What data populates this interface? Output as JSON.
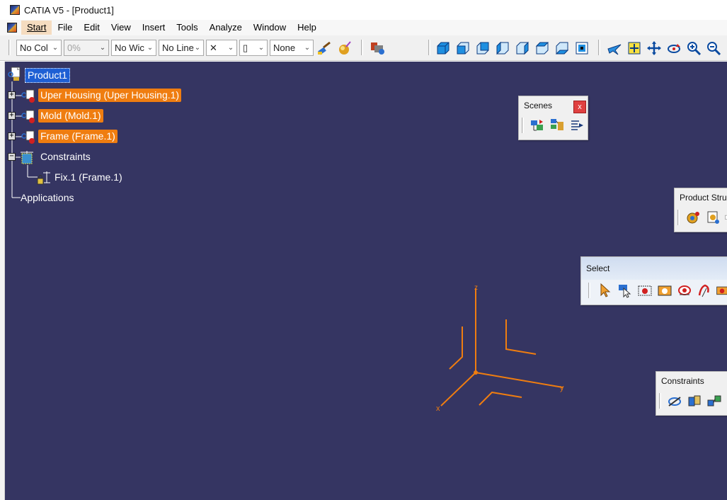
{
  "window": {
    "title": "CATIA V5 - [Product1]"
  },
  "menu": {
    "items": [
      {
        "label": "Start",
        "active": true
      },
      {
        "label": "File"
      },
      {
        "label": "Edit"
      },
      {
        "label": "View"
      },
      {
        "label": "Insert"
      },
      {
        "label": "Tools"
      },
      {
        "label": "Analyze"
      },
      {
        "label": "Window"
      },
      {
        "label": "Help"
      }
    ]
  },
  "toolbar": {
    "color_select": "No Col",
    "transparency_select": "0%",
    "width_select": "No Wic",
    "linetype_select": "No Line",
    "point_select": "✕",
    "layer_select": "▯",
    "render_select": "None",
    "view_icons": [
      "isometric-view-icon",
      "front-view-icon",
      "back-view-icon",
      "left-view-icon",
      "right-view-icon",
      "top-view-icon",
      "bottom-view-icon",
      "named-views-icon"
    ],
    "nav_icons": [
      "fly-mode-icon",
      "fit-all-icon",
      "pan-icon",
      "rotate-icon",
      "zoom-in-icon",
      "zoom-out-icon"
    ]
  },
  "tree": {
    "root": "Product1",
    "parts": [
      {
        "label": "Uper Housing (Uper Housing.1)"
      },
      {
        "label": "Mold (Mold.1)"
      },
      {
        "label": "Frame (Frame.1)"
      }
    ],
    "constraints": "Constraints",
    "fix": "Fix.1 (Frame.1)",
    "applications": "Applications"
  },
  "axis": {
    "x": "x",
    "y": "y",
    "z": "z",
    "color": "#ef7d10"
  },
  "panels": {
    "scenes": {
      "title": "Scenes",
      "close": "x"
    },
    "product_structure": {
      "title": "Product Stru"
    },
    "select": {
      "title": "Select"
    },
    "constraints": {
      "title": "Constraints"
    }
  },
  "colors": {
    "viewport": "#353562",
    "highlight": "#ef7d10",
    "selection": "#1e5fd4"
  }
}
